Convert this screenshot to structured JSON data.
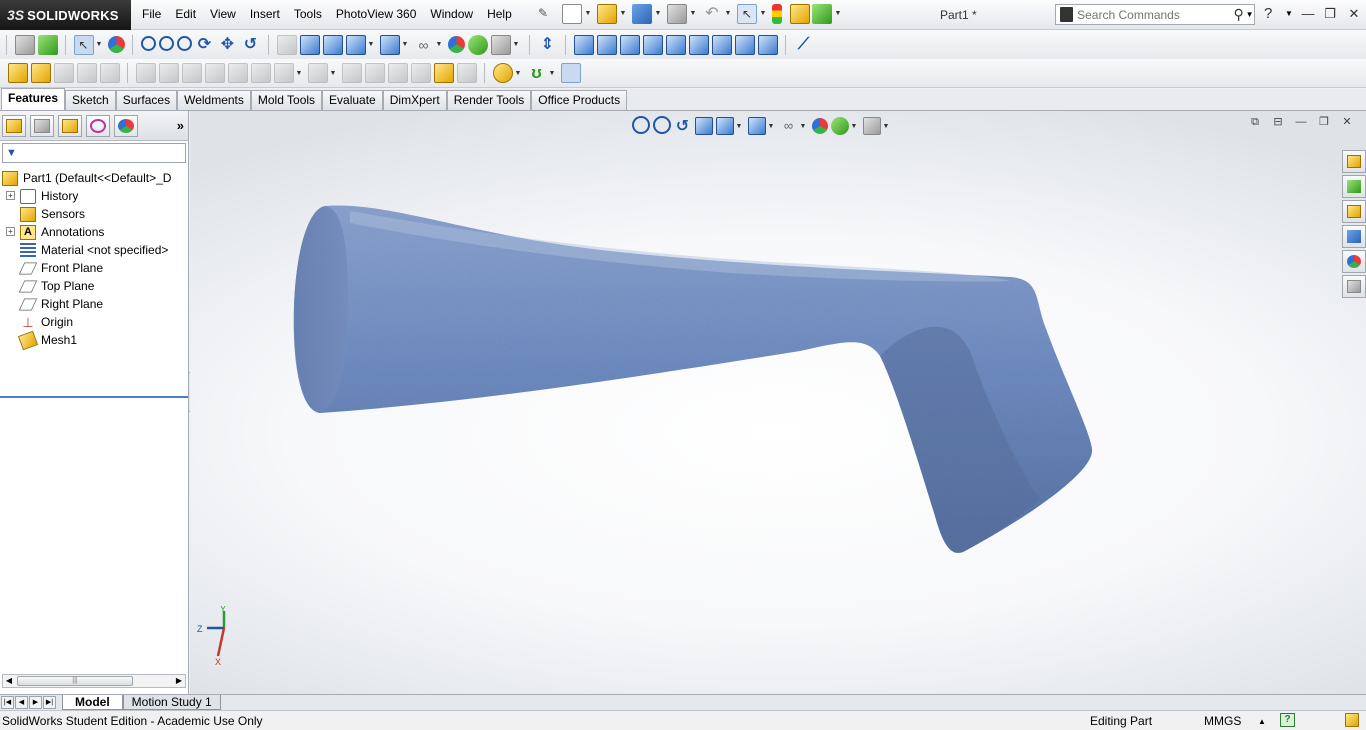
{
  "app": {
    "brand_prefix": "3S",
    "brand_name": "SOLIDWORKS",
    "document_title": "Part1 *"
  },
  "menu": [
    "File",
    "Edit",
    "View",
    "Insert",
    "Tools",
    "PhotoView 360",
    "Window",
    "Help"
  ],
  "search": {
    "placeholder": "Search Commands"
  },
  "command_tabs": [
    "Features",
    "Sketch",
    "Surfaces",
    "Weldments",
    "Mold Tools",
    "Evaluate",
    "DimXpert",
    "Render Tools",
    "Office Products"
  ],
  "active_command_tab": "Features",
  "feature_tree": {
    "root": "Part1  (Default<<Default>_D",
    "items": [
      {
        "label": "History",
        "icon": "history-icon",
        "expandable": true
      },
      {
        "label": "Sensors",
        "icon": "sensors-icon",
        "expandable": false
      },
      {
        "label": "Annotations",
        "icon": "annotations-icon",
        "expandable": true
      },
      {
        "label": "Material <not specified>",
        "icon": "material-icon",
        "expandable": false
      },
      {
        "label": "Front Plane",
        "icon": "plane-icon",
        "expandable": false
      },
      {
        "label": "Top Plane",
        "icon": "plane-icon",
        "expandable": false
      },
      {
        "label": "Right Plane",
        "icon": "plane-icon",
        "expandable": false
      },
      {
        "label": "Origin",
        "icon": "origin-icon",
        "expandable": false
      },
      {
        "label": "Mesh1",
        "icon": "mesh-icon",
        "expandable": false
      }
    ]
  },
  "triad": {
    "x": "X",
    "y": "Y",
    "z": "Z"
  },
  "bottom_tabs": [
    "Model",
    "Motion Study 1"
  ],
  "status": {
    "edition": "SolidWorks Student Edition - Academic Use Only",
    "mode": "Editing Part",
    "units": "MMGS",
    "units_arrow": "▲"
  },
  "colors": {
    "part": "#6f8fc4",
    "accent": "#1f57a8"
  }
}
